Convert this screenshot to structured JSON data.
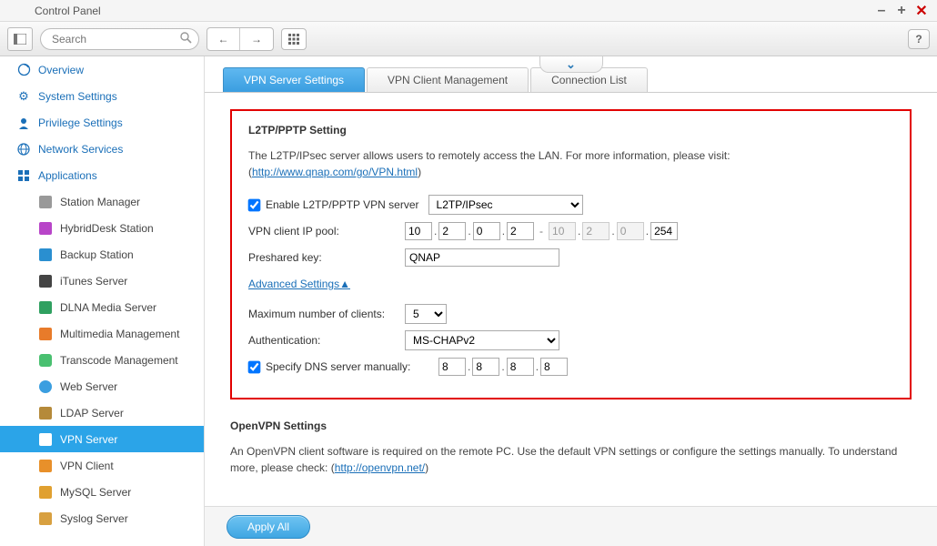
{
  "window": {
    "title": "Control Panel"
  },
  "toolbar": {
    "search_placeholder": "Search",
    "help": "?"
  },
  "sidebar": {
    "top": [
      {
        "label": "Overview"
      },
      {
        "label": "System Settings"
      },
      {
        "label": "Privilege Settings"
      },
      {
        "label": "Network Services"
      },
      {
        "label": "Applications"
      }
    ],
    "apps": [
      {
        "label": "Station Manager"
      },
      {
        "label": "HybridDesk Station"
      },
      {
        "label": "Backup Station"
      },
      {
        "label": "iTunes Server"
      },
      {
        "label": "DLNA Media Server"
      },
      {
        "label": "Multimedia Management"
      },
      {
        "label": "Transcode Management"
      },
      {
        "label": "Web Server"
      },
      {
        "label": "LDAP Server"
      },
      {
        "label": "VPN Server"
      },
      {
        "label": "VPN Client"
      },
      {
        "label": "MySQL Server"
      },
      {
        "label": "Syslog Server"
      }
    ]
  },
  "tabs": [
    {
      "label": "VPN Server Settings"
    },
    {
      "label": "VPN Client Management"
    },
    {
      "label": "Connection List"
    }
  ],
  "l2tp": {
    "title": "L2TP/PPTP Setting",
    "desc_prefix": "The L2TP/IPsec server allows users to remotely access the LAN. For more information, please visit: (",
    "link": "http://www.qnap.com/go/VPN.html",
    "desc_suffix": ")",
    "enable_label": "Enable L2TP/PPTP VPN server",
    "proto": "L2TP/IPsec",
    "ip_pool_label": "VPN client IP pool:",
    "ip_start": [
      "10",
      "2",
      "0",
      "2"
    ],
    "ip_end": [
      "10",
      "2",
      "0",
      "254"
    ],
    "psk_label": "Preshared key:",
    "psk_value": "QNAP",
    "adv_label": "Advanced Settings▲",
    "max_clients_label": "Maximum number of clients:",
    "max_clients": "5",
    "auth_label": "Authentication:",
    "auth_value": "MS-CHAPv2",
    "dns_label": "Specify DNS server manually:",
    "dns": [
      "8",
      "8",
      "8",
      "8"
    ]
  },
  "openvpn": {
    "title": "OpenVPN Settings",
    "desc_prefix": "An OpenVPN client software is required on the remote PC. Use the default VPN settings or configure the settings manually. To understand more, please check: (",
    "link": "http://openvpn.net/",
    "desc_suffix": ")"
  },
  "footer": {
    "apply": "Apply All"
  }
}
